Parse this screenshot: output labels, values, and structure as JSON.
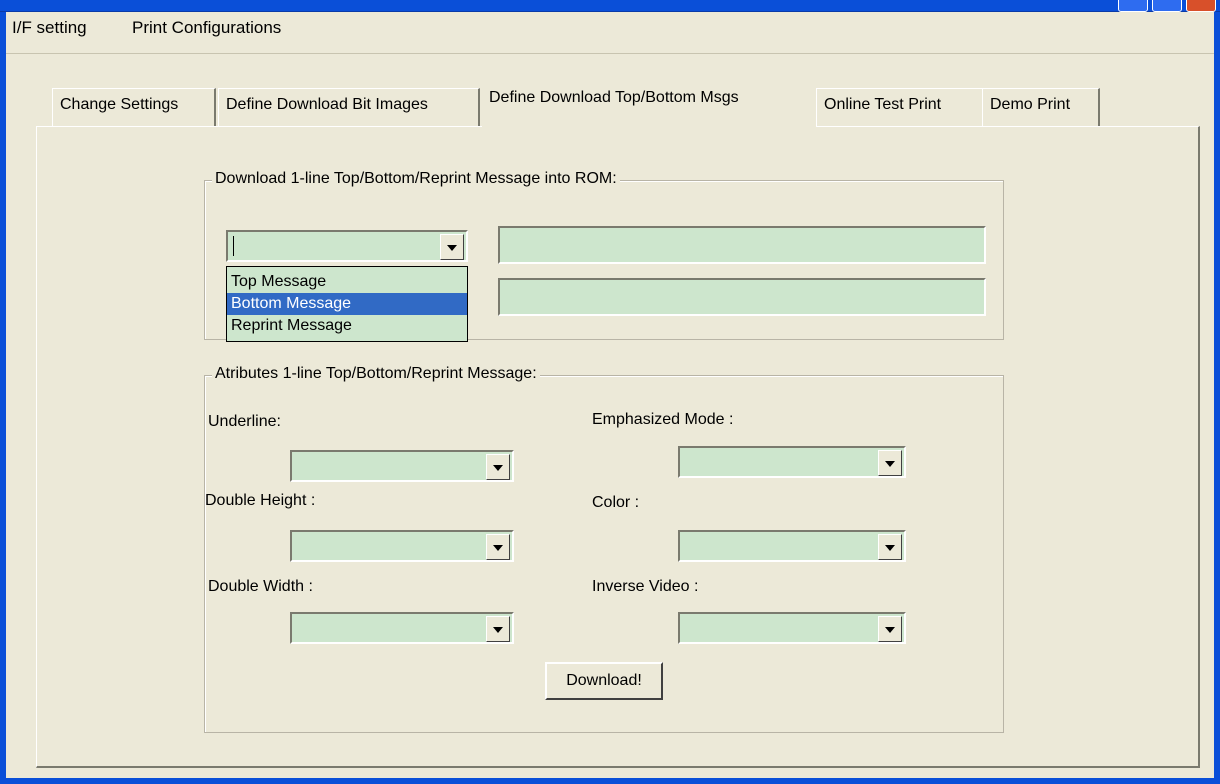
{
  "menu": {
    "items": [
      "I/F setting",
      "Print Configurations"
    ]
  },
  "tabs": [
    {
      "label": "Change Settings",
      "active": false
    },
    {
      "label": "Define Download Bit Images",
      "active": false
    },
    {
      "label": "Define Download Top/Bottom Msgs",
      "active": true
    },
    {
      "label": "Online Test Print",
      "active": false
    },
    {
      "label": "Demo Print",
      "active": false
    }
  ],
  "download_group": {
    "legend": "Download 1-line Top/Bottom/Reprint Message into ROM:",
    "message_type": {
      "value": "",
      "options": [
        "Top Message",
        "Bottom Message",
        "Reprint Message"
      ],
      "highlighted": "Bottom Message"
    },
    "message_text_1": "",
    "message_text_2": ""
  },
  "attributes_group": {
    "legend": "Atributes 1-line Top/Bottom/Reprint Message:",
    "underline_label": "Underline:",
    "double_height_label": "Double Height :",
    "double_width_label": "Double Width :",
    "emphasized_label": "Emphasized Mode :",
    "color_label": "Color :",
    "inverse_video_label": "Inverse Video :",
    "download_button": "Download!"
  },
  "colors": {
    "window_bg": "#ece9d8",
    "field_bg": "#cde6cd",
    "selection": "#316ac5",
    "title_bar": "#0a4fd8"
  }
}
